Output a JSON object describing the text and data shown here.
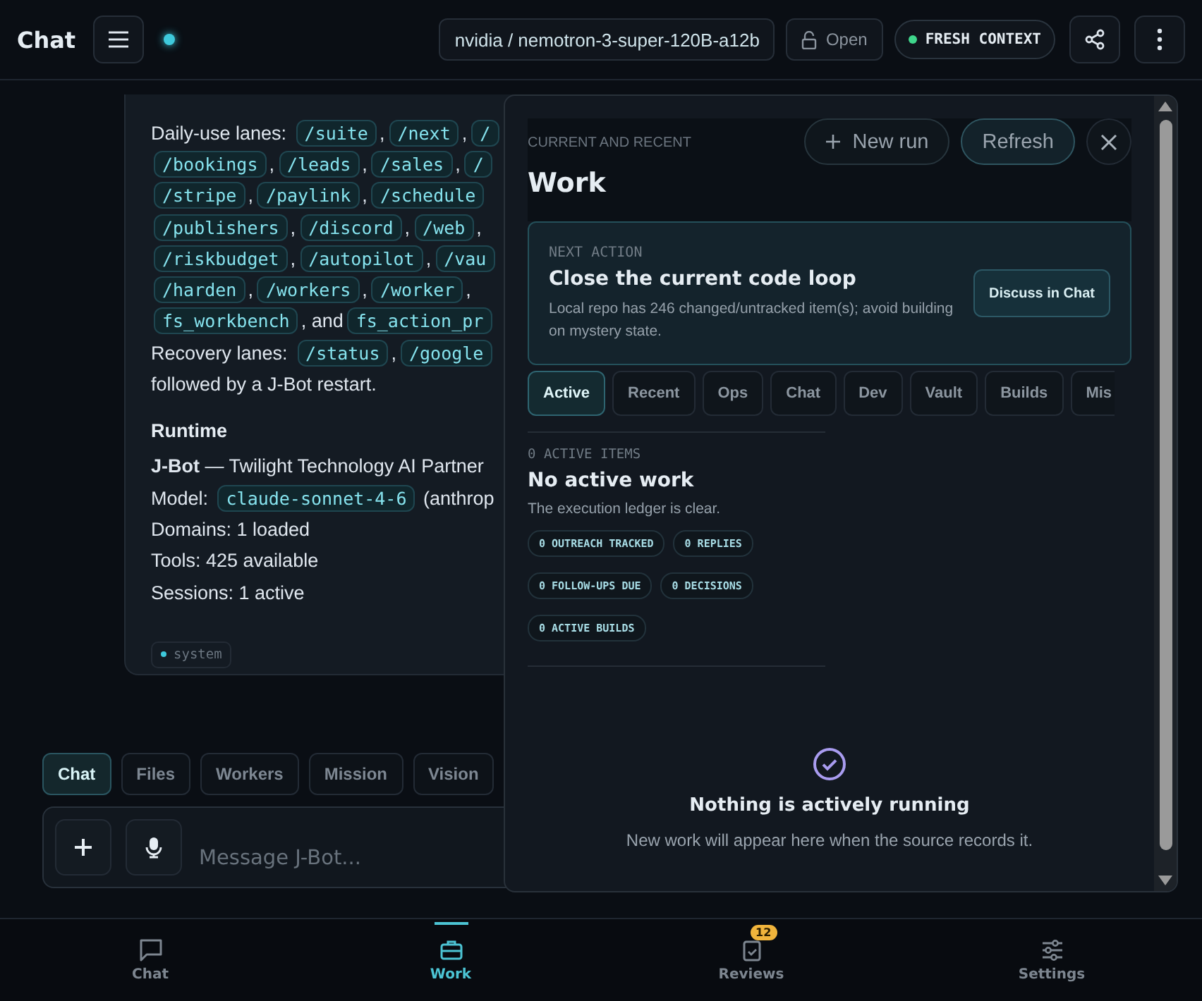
{
  "header": {
    "title": "Chat",
    "connected": true,
    "model": "nvidia / nemotron-3-super-120B-a12b",
    "lock_label": "Open",
    "context_badge": "FRESH CONTEXT"
  },
  "message": {
    "lines": [
      [
        {
          "kind": "text",
          "text": "Daily-use lanes: "
        },
        {
          "kind": "code",
          "text": "/suite"
        },
        {
          "kind": "text",
          "text": ","
        },
        {
          "kind": "code",
          "text": "/next"
        },
        {
          "kind": "text",
          "text": ","
        },
        {
          "kind": "code",
          "text": "/"
        }
      ],
      [
        {
          "kind": "code",
          "text": "/bookings"
        },
        {
          "kind": "text",
          "text": ","
        },
        {
          "kind": "code",
          "text": "/leads"
        },
        {
          "kind": "text",
          "text": ","
        },
        {
          "kind": "code",
          "text": "/sales"
        },
        {
          "kind": "text",
          "text": ","
        },
        {
          "kind": "code",
          "text": "/"
        }
      ],
      [
        {
          "kind": "code",
          "text": "/stripe"
        },
        {
          "kind": "text",
          "text": ","
        },
        {
          "kind": "code",
          "text": "/paylink"
        },
        {
          "kind": "text",
          "text": ","
        },
        {
          "kind": "code",
          "text": "/schedule"
        }
      ],
      [
        {
          "kind": "code",
          "text": "/publishers"
        },
        {
          "kind": "text",
          "text": ","
        },
        {
          "kind": "code",
          "text": "/discord"
        },
        {
          "kind": "text",
          "text": ","
        },
        {
          "kind": "code",
          "text": "/web"
        },
        {
          "kind": "text",
          "text": ","
        }
      ],
      [
        {
          "kind": "code",
          "text": "/riskbudget"
        },
        {
          "kind": "text",
          "text": ","
        },
        {
          "kind": "code",
          "text": "/autopilot"
        },
        {
          "kind": "text",
          "text": ","
        },
        {
          "kind": "code",
          "text": "/vau"
        }
      ],
      [
        {
          "kind": "code",
          "text": "/harden"
        },
        {
          "kind": "text",
          "text": ","
        },
        {
          "kind": "code",
          "text": "/workers"
        },
        {
          "kind": "text",
          "text": ","
        },
        {
          "kind": "code",
          "text": "/worker"
        },
        {
          "kind": "text",
          "text": ","
        }
      ],
      [
        {
          "kind": "code",
          "text": "fs_workbench"
        },
        {
          "kind": "text",
          "text": ", and"
        },
        {
          "kind": "code",
          "text": "fs_action_pr"
        }
      ],
      [
        {
          "kind": "text",
          "text": "Recovery lanes: "
        },
        {
          "kind": "code",
          "text": "/status"
        },
        {
          "kind": "text",
          "text": ","
        },
        {
          "kind": "code",
          "text": "/google"
        }
      ],
      [
        {
          "kind": "text",
          "text": "followed by a J-Bot restart."
        }
      ]
    ],
    "runtime_title": "Runtime",
    "runtime_lines": [
      [
        {
          "kind": "text",
          "text": "**J-Bot** — Twilight Technology AI Partner"
        }
      ],
      [
        {
          "kind": "text",
          "text": "Model: "
        },
        {
          "kind": "code",
          "text": "claude-sonnet-4-6"
        },
        {
          "kind": "text",
          "text": " (anthrop"
        }
      ],
      [
        {
          "kind": "text",
          "text": "Domains: 1 loaded"
        }
      ],
      [
        {
          "kind": "text",
          "text": "Tools: 425 available"
        }
      ],
      [
        {
          "kind": "text",
          "text": "Sessions: 1 active"
        }
      ]
    ],
    "tag": "system"
  },
  "composer_tabs": [
    {
      "label": "Chat",
      "selected": true
    },
    {
      "label": "Files",
      "selected": false
    },
    {
      "label": "Workers",
      "selected": false
    },
    {
      "label": "Mission",
      "selected": false
    },
    {
      "label": "Vision",
      "selected": false
    }
  ],
  "composer": {
    "placeholder": "Message J-Bot..."
  },
  "panel": {
    "eyebrow": "CURRENT AND RECENT",
    "title": "Work",
    "new_run": "New run",
    "refresh": "Refresh",
    "next_action": {
      "eyebrow": "NEXT ACTION",
      "title": "Close the current code loop",
      "body": "Local repo has 246 changed/untracked item(s); avoid building on mystery state.",
      "button": "Discuss in Chat"
    },
    "tabs": [
      {
        "label": "Active",
        "selected": true
      },
      {
        "label": "Recent",
        "selected": false
      },
      {
        "label": "Ops",
        "selected": false
      },
      {
        "label": "Chat",
        "selected": false
      },
      {
        "label": "Dev",
        "selected": false
      },
      {
        "label": "Vault",
        "selected": false
      },
      {
        "label": "Builds",
        "selected": false
      },
      {
        "label": "Mis",
        "selected": false
      }
    ],
    "section": {
      "count_label": "0 ACTIVE ITEMS",
      "title": "No active work",
      "body": "The execution ledger is clear.",
      "chips": [
        "0 OUTREACH TRACKED",
        "0 REPLIES",
        "0 FOLLOW-UPS DUE",
        "0 DECISIONS",
        "0 ACTIVE BUILDS"
      ]
    },
    "empty": {
      "title": "Nothing is actively running",
      "body": "New work will appear here when the source records it."
    }
  },
  "nav": [
    {
      "label": "Chat",
      "selected": false
    },
    {
      "label": "Work",
      "selected": true
    },
    {
      "label": "Reviews",
      "selected": false,
      "badge": "12"
    },
    {
      "label": "Settings",
      "selected": false
    }
  ]
}
